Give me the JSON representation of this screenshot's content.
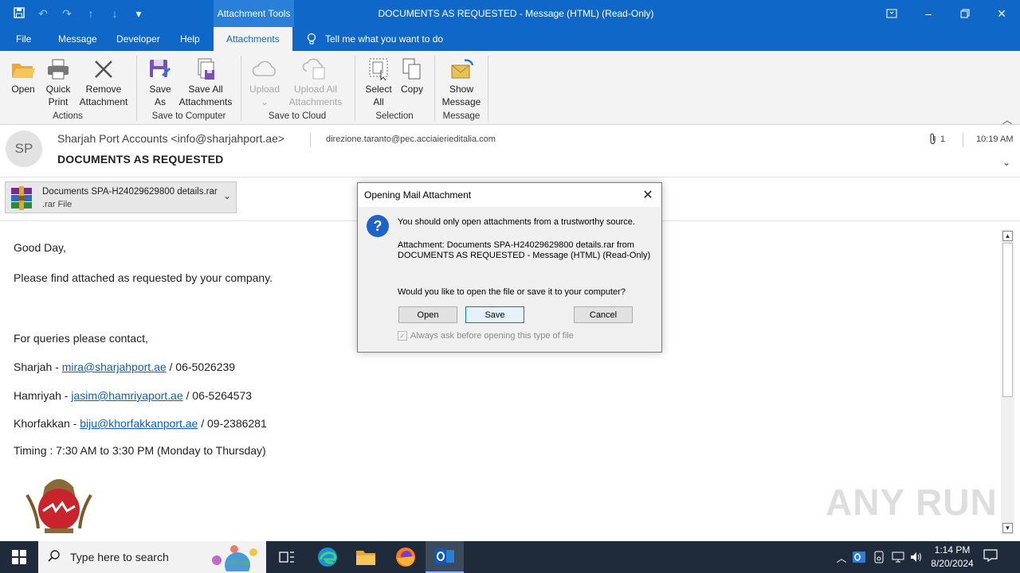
{
  "window": {
    "title": "DOCUMENTS AS REQUESTED  -  Message (HTML) (Read-Only)",
    "context_tab": "Attachment Tools"
  },
  "ribbon_tabs": [
    "File",
    "Message",
    "Developer",
    "Help",
    "Attachments"
  ],
  "tell_me": "Tell me what you want to do",
  "ribbon": {
    "open": "Open",
    "quick_print_1": "Quick",
    "quick_print_2": "Print",
    "remove_1": "Remove",
    "remove_2": "Attachment",
    "group_actions": "Actions",
    "save_as_1": "Save",
    "save_as_2": "As",
    "save_all_1": "Save All",
    "save_all_2": "Attachments",
    "group_save_computer": "Save to Computer",
    "upload": "Upload",
    "upload_all_1": "Upload All",
    "upload_all_2": "Attachments",
    "group_save_cloud": "Save to Cloud",
    "select_all_1": "Select",
    "select_all_2": "All",
    "copy": "Copy",
    "group_selection": "Selection",
    "show_msg_1": "Show",
    "show_msg_2": "Message",
    "group_message": "Message"
  },
  "header": {
    "avatar": "SP",
    "sender": "Sharjah Port Accounts <info@sharjahport.ae>",
    "recipient": "direzione.taranto@pec.acciaierieditalia.com",
    "attachment_count": "1",
    "time": "10:19 AM",
    "subject": "DOCUMENTS AS REQUESTED"
  },
  "attachment": {
    "name": "Documents SPA-H24029629800 details.rar",
    "type": ".rar File"
  },
  "body": {
    "greeting": "Good Day,",
    "line1": "Please find attached as requested by your company.",
    "contact_intro": "For queries please contact,",
    "sharjah_label": "Sharjah - ",
    "sharjah_email": "mira@sharjahport.ae",
    "sharjah_phone": " / 06-5026239",
    "hamriyah_label": "Hamriyah - ",
    "hamriyah_email": "jasim@hamriyaport.ae",
    "hamriyah_phone": "  / 06-5264573",
    "khorfakkan_label": "Khorfakkan - ",
    "khorfakkan_email": "biju@khorfakkanport.ae",
    "khorfakkan_phone": " / 09-2386281",
    "timing": "Timing : 7:30 AM to 3:30 PM (Monday to Thursday)"
  },
  "watermark": "ANY RUN",
  "dialog": {
    "title": "Opening Mail Attachment",
    "warning": "You should only open attachments from a trustworthy source.",
    "attachment_line1": "Attachment: Documents SPA-H24029629800 details.rar from",
    "attachment_line2": "DOCUMENTS AS REQUESTED - Message (HTML) (Read-Only)",
    "question": "Would you like to open the file or save it to your computer?",
    "open_button": "Open",
    "save_button": "Save",
    "cancel_button": "Cancel",
    "checkbox": "Always ask before opening this type of file",
    "checkbox_checked": true
  },
  "taskbar": {
    "search_placeholder": "Type here to search",
    "time": "1:14 PM",
    "date": "8/20/2024"
  },
  "colors": {
    "accent": "#0f68c7",
    "link": "#0a5fc4",
    "taskbar": "#1f2b3a"
  }
}
